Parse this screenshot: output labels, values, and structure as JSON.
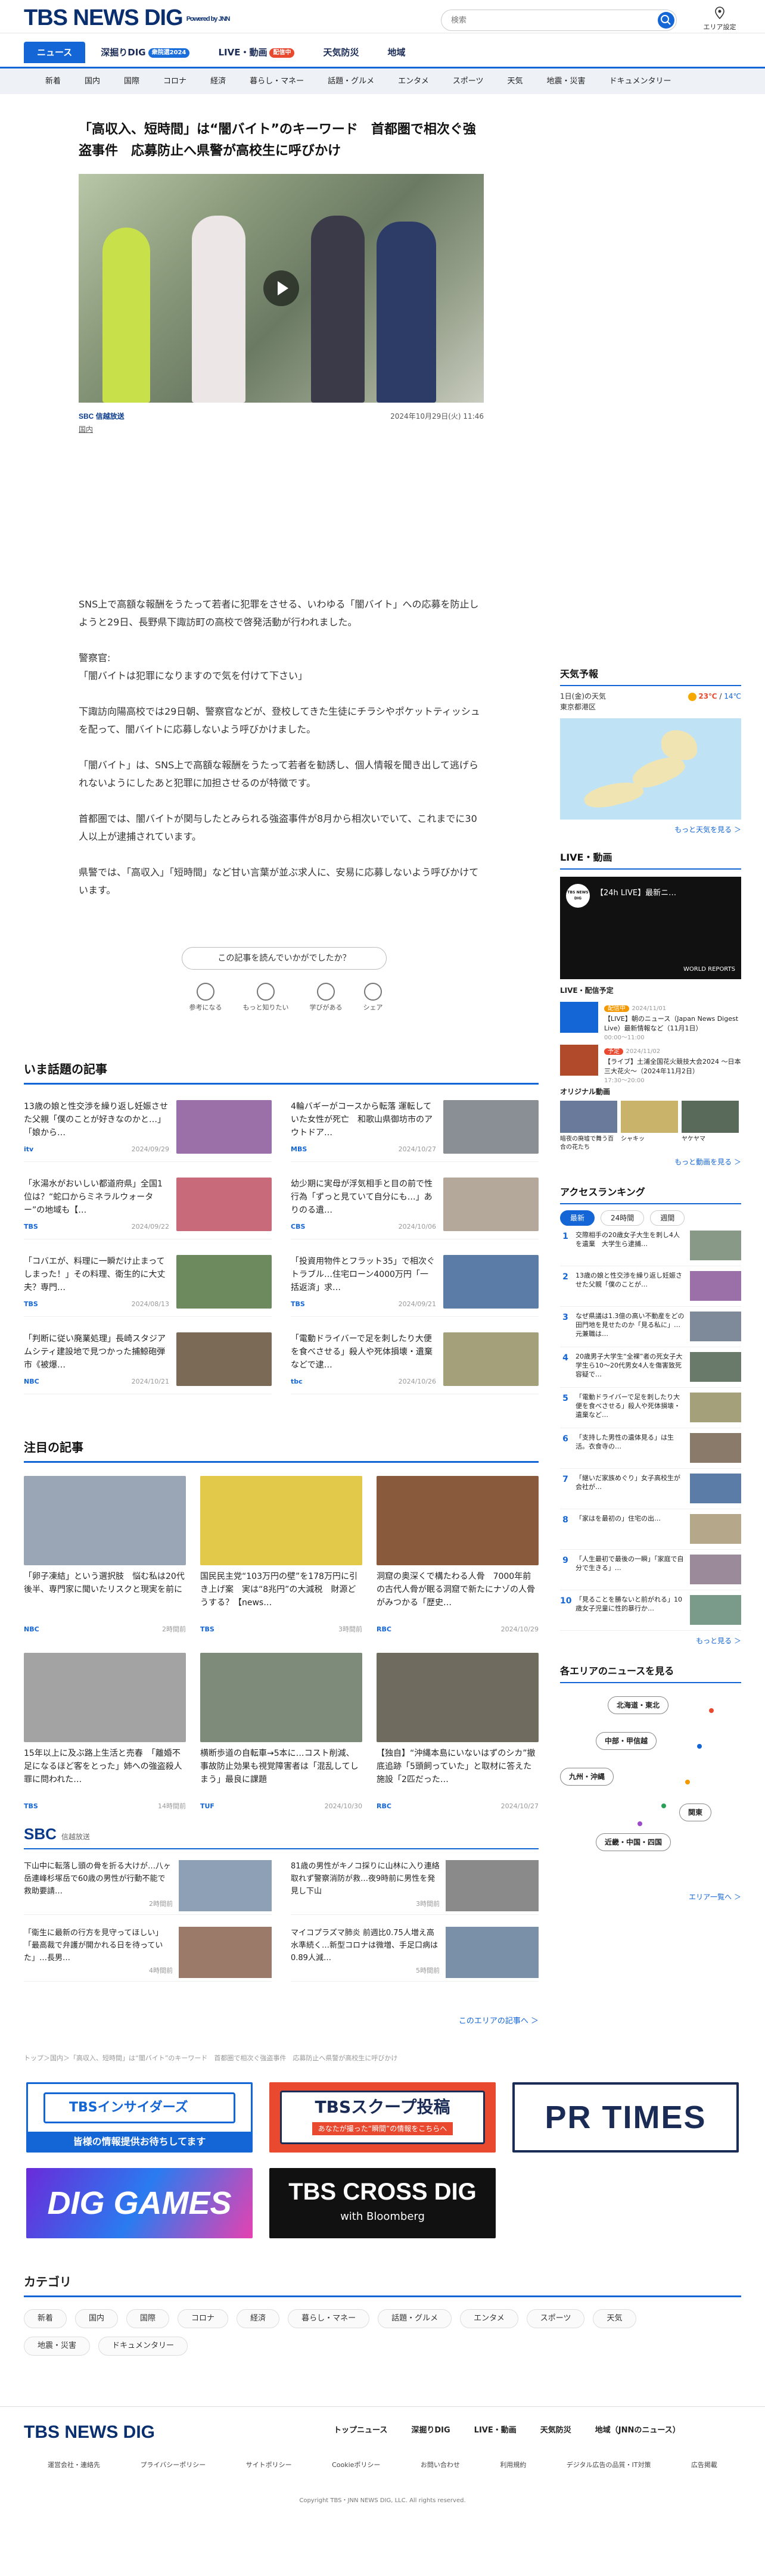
{
  "header": {
    "logo": "TBS NEWS DIG",
    "powered": "Powered by JNN",
    "search_placeholder": "検索",
    "area_label": "エリア設定"
  },
  "nav1": [
    {
      "label": "ニュース"
    },
    {
      "label": "深掘りDIG",
      "badge": "衆院選2024"
    },
    {
      "label": "LIVE・動画",
      "badge": "配信中"
    },
    {
      "label": "天気防災"
    },
    {
      "label": "地域"
    }
  ],
  "nav2": [
    "新着",
    "国内",
    "国際",
    "コロナ",
    "経済",
    "暮らし・マネー",
    "話題・グルメ",
    "エンタメ",
    "スポーツ",
    "天気",
    "地震・災害",
    "ドキュメンタリー"
  ],
  "article": {
    "title": "「高収入、短時間」は“闇バイト”のキーワード　首都圏で相次ぐ強盗事件　応募防止へ県警が高校生に呼びかけ",
    "source": "SBC 信越放送",
    "date": "2024年10月29日(火) 11:46",
    "category": "国内",
    "paragraphs": [
      "SNS上で高額な報酬をうたって若者に犯罪をさせる、いわゆる「闇バイト」への応募を防止しようと29日、長野県下諏訪町の高校で啓発活動が行われました。",
      "警察官:\n「闇バイトは犯罪になりますので気を付けて下さい」",
      "下諏訪向陽高校では29日朝、警察官などが、登校してきた生徒にチラシやポケットティッシュを配って、闇バイトに応募しないよう呼びかけました。",
      "「闇バイト」は、SNS上で高額な報酬をうたって若者を勧誘し、個人情報を聞き出して逃げられないようにしたあと犯罪に加担させるのが特徴です。",
      "首都圏では、闇バイトが関与したとみられる強盗事件が8月から相次いでいて、これまでに30人以上が逮捕されています。",
      "県警では、「高収入」「短時間」など甘い言葉が並ぶ求人に、安易に応募しないよう呼びかけています。"
    ],
    "survey": "この記事を読んでいかがでしたか？",
    "reactions": [
      "参考になる",
      "もっと知りたい",
      "学びがある",
      "シェア"
    ]
  },
  "hot": {
    "title": "いま話題の記事",
    "items": [
      {
        "title": "13歳の娘と性交渉を繰り返し妊娠させた父親「僕のことが好きなのかと…」「娘から…",
        "tv": "itv",
        "date": "2024/09/29"
      },
      {
        "title": "4輪バギーがコースから転落 運転していた女性が死亡　和歌山県御坊市のアウトドア…",
        "tv": "MBS",
        "date": "2024/10/27"
      },
      {
        "title": "「氷湯水がおいしい都道府県」全国1位は？“蛇口からミネラルウォーター”の地域も【…",
        "tv": "TBS",
        "date": "2024/09/22"
      },
      {
        "title": "幼少期に実母が浮気相手と目の前で性行為「ずっと見ていて自分にも…」ありのる遺…",
        "tv": "CBS",
        "date": "2024/10/06"
      },
      {
        "title": "「コバエが、料理に一瞬だけ止まってしまった！」その料理、衛生的に大丈夫？専門…",
        "tv": "TBS",
        "date": "2024/08/13"
      },
      {
        "title": "「投資用物件とフラット35」で相次ぐトラブル…住宅ローン4000万円「一括返済」求…",
        "tv": "TBS",
        "date": "2024/09/21"
      },
      {
        "title": "「判断に従い廃業処理」長崎スタジアムシティ建設地で見つかった捕鯨砲弾市《被爆…",
        "tv": "NBC",
        "date": "2024/10/21"
      },
      {
        "title": "「電動ドライバーで足を刺したり大便を食べさせる」殺人や死体損壊・遺棄などで逮…",
        "tv": "tbc",
        "date": "2024/10/26"
      }
    ]
  },
  "focus": {
    "title": "注目の記事",
    "items": [
      {
        "title": "「卵子凍結」という選択肢　悩む私は20代後半、専門家に聞いたリスクと現実を前に",
        "tv": "NBC",
        "date": "2時間前"
      },
      {
        "title": "国民民主党“103万円の壁”を178万円に引き上げ案　実は“8兆円”の大減税　財源どうする？【news…",
        "tv": "TBS",
        "date": "3時間前"
      },
      {
        "title": "洞窟の奥深くで構たわる人骨　7000年前の古代人骨が眠る洞窟で新たにナゾの人骨がみつかる「歴史…",
        "tv": "RBC",
        "date": "2024/10/29"
      },
      {
        "title": "15年以上に及ぶ路上生活と売春　「離婚不足になるほど客をとった」姉への強盗殺人罪に問われた…",
        "tv": "TBS",
        "date": "14時間前"
      },
      {
        "title": "横断歩道の自転車→5本に…コスト削減、事故防止効果も視覚障害者は「混乱してしまう」最良に課題",
        "tv": "TUF",
        "date": "2024/10/30"
      },
      {
        "title": "【独自】“沖縄本島にいないはずのシカ”撤底追跡「5頭飼っていた」と取材に答えた施設「2匹だった…",
        "tv": "RBC",
        "date": "2024/10/27"
      }
    ]
  },
  "sbc": {
    "logo": "SBC",
    "label": "信越放送",
    "items": [
      {
        "title": "下山中に転落し頭の骨を折る大けが…八ヶ岳連峰杉塚岳で60歳の男性が行動不能で救助要請…",
        "date": "2時間前"
      },
      {
        "title": "81歳の男性がキノコ採りに山林に入り連絡取れず警察消防が救…夜9時前に男性を発見し下山",
        "date": "3時間前"
      },
      {
        "title": "「衛生に最新の行方を見守ってほしい」「最高裁で弁護が開かれる日を待っていた」…長男…",
        "date": "4時間前"
      },
      {
        "title": "マイコプラズマ肺炎 前週比0.75人増え高水準続く…新型コロナは微増、手足口病は0.89人減…",
        "date": "5時間前"
      }
    ],
    "more": "このエリアの記事へ ＞"
  },
  "breadcrumb": "トップ＞国内＞「高収入、短時間」は“闇バイト”のキーワード　首都圏で相次ぐ強盗事件　応募防止へ県警が高校生に呼びかけ",
  "banners": {
    "b1a": "TBSインサイダーズ",
    "b1b": "皆様の情報提供お待ちしてます",
    "b2a": "TBSスクープ投稿",
    "b2b": "あなたが撮った“瞬間”の情報をこちらへ",
    "b3": "PR TIMES",
    "b4": "DIG GAMES",
    "b5a": "TBS CROSS DIG",
    "b5b": "with Bloomberg"
  },
  "categories": {
    "title": "カテゴリ",
    "items": [
      "新着",
      "国内",
      "国際",
      "コロナ",
      "経済",
      "暮らし・マネー",
      "話題・グルメ",
      "エンタメ",
      "スポーツ",
      "天気",
      "地震・災害",
      "ドキュメンタリー"
    ]
  },
  "footer": {
    "logo": "TBS NEWS DIG",
    "nav": [
      "トップニュース",
      "深掘りDIG",
      "LIVE・動画",
      "天気防災",
      "地域（JNNのニュース）"
    ],
    "links": [
      "運営会社・連絡先",
      "プライバシーポリシー",
      "サイトポリシー",
      "Cookieポリシー",
      "お問い合わせ",
      "利用規約",
      "デジタル広告の品質・IT対策",
      "広告掲載"
    ],
    "copy": "Copyright TBS・JNN NEWS DIG, LLC. All rights reserved."
  },
  "sidebar": {
    "weather": {
      "title": "天気予報",
      "date": "1日(金)の天気",
      "place": "東京都港区",
      "hi": "23℃",
      "lo": "14℃",
      "more": "もっと天気を見る ＞"
    },
    "live": {
      "title": "LIVE・動画",
      "player_title": "【24h LIVE】最新ニ…",
      "channel": "TBS NEWS DIG",
      "wr": "WORLD REPORTS",
      "sched": "LIVE・配信予定",
      "rows": [
        {
          "label": "配信中",
          "date": "2024/11/01",
          "title": "【LIVE】朝のニュース（Japan News Digest Live）最新情報など（11月1日）",
          "time": "00:00〜11:00"
        },
        {
          "label": "予定",
          "date": "2024/11/02",
          "title": "【ライブ】土浦全国花火競技大会2024 ～日本三大花火～（2024年11月2日）",
          "time": "17:30〜20:00"
        }
      ],
      "orig": "オリジナル動画",
      "orig_items": [
        "暗夜の廃墟で舞う百合の花たち",
        "シャキッ",
        "ヤケヤマ"
      ],
      "more": "もっと動画を見る ＞"
    },
    "rank": {
      "title": "アクセスランキング",
      "tabs": [
        "最新",
        "24時間",
        "週間"
      ],
      "items": [
        "交際相手の20歳女子大生を刺し4人を遺棄　大学生ら逮捕…",
        "13歳の娘と性交渉を繰り返し妊娠させた父親「僕のことが…",
        "なぜ県議は1.3億の高い不動産をどの田門地を見せたのか「見る私に」…元兼職は…",
        "20歳男子大学生“全裸”者の死女子大学生ら10〜20代男女4人を傷害致死容疑で…",
        "「電動ドライバーで足を刺したり大便を食べさせる」殺人や死体損壊・遺棄など…",
        "「支持した男性の遺体見る」は生活。衣食寺の…",
        "「継いだ家族めぐり」女子高校生が会社が…",
        "「家はを最初の」住宅の出…",
        "「人生最初で最後の一瞬」「家庭で自分で生きる」…",
        "「見ることを勝ないと前がれる」10歳女子児童に性的暴行か…"
      ],
      "more": "もっと見る ＞"
    },
    "area": {
      "title": "各エリアのニュースを見る",
      "btns": [
        "北海道・東北",
        "中部・甲信越",
        "九州・沖縄",
        "関東",
        "近畿・中国・四国"
      ],
      "more": "エリア一覧へ ＞"
    }
  }
}
